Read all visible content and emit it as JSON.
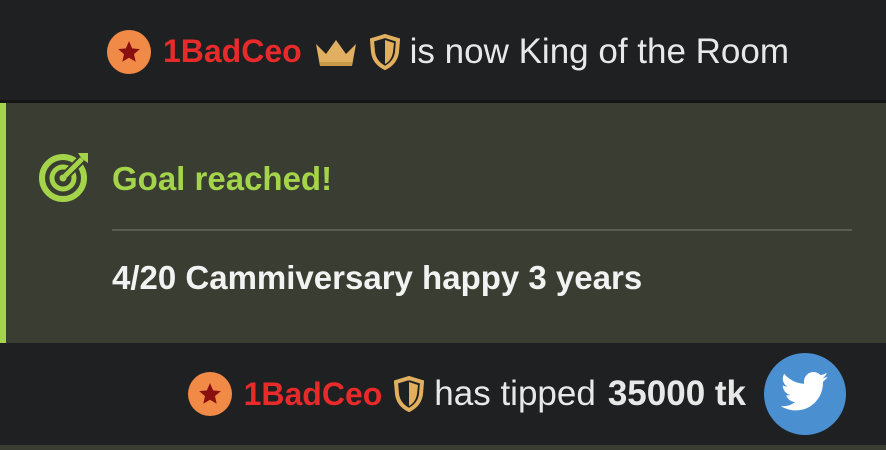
{
  "king_message": {
    "username": "1BadCeo",
    "badge_icon": "star-badge-icon",
    "crown_icon": "crown-icon",
    "shield_icon": "shield-icon",
    "text": "is now King of the Room"
  },
  "goal": {
    "icon": "target-arrow-icon",
    "title": "Goal reached!",
    "description": "4/20 Cammiversary happy 3 years"
  },
  "tip_message": {
    "username": "1BadCeo",
    "badge_icon": "star-badge-icon",
    "shield_icon": "shield-icon",
    "text": "has tipped",
    "amount": "35000 tk",
    "share_icon": "twitter-bird-icon"
  },
  "colors": {
    "background": "#1f2021",
    "goal_background": "#3a3d31",
    "goal_accent": "#a3d44a",
    "username": "#e82a2a",
    "badge": "#f08a46",
    "crown_shield": "#e0b060",
    "twitter": "#4a8fd0"
  }
}
